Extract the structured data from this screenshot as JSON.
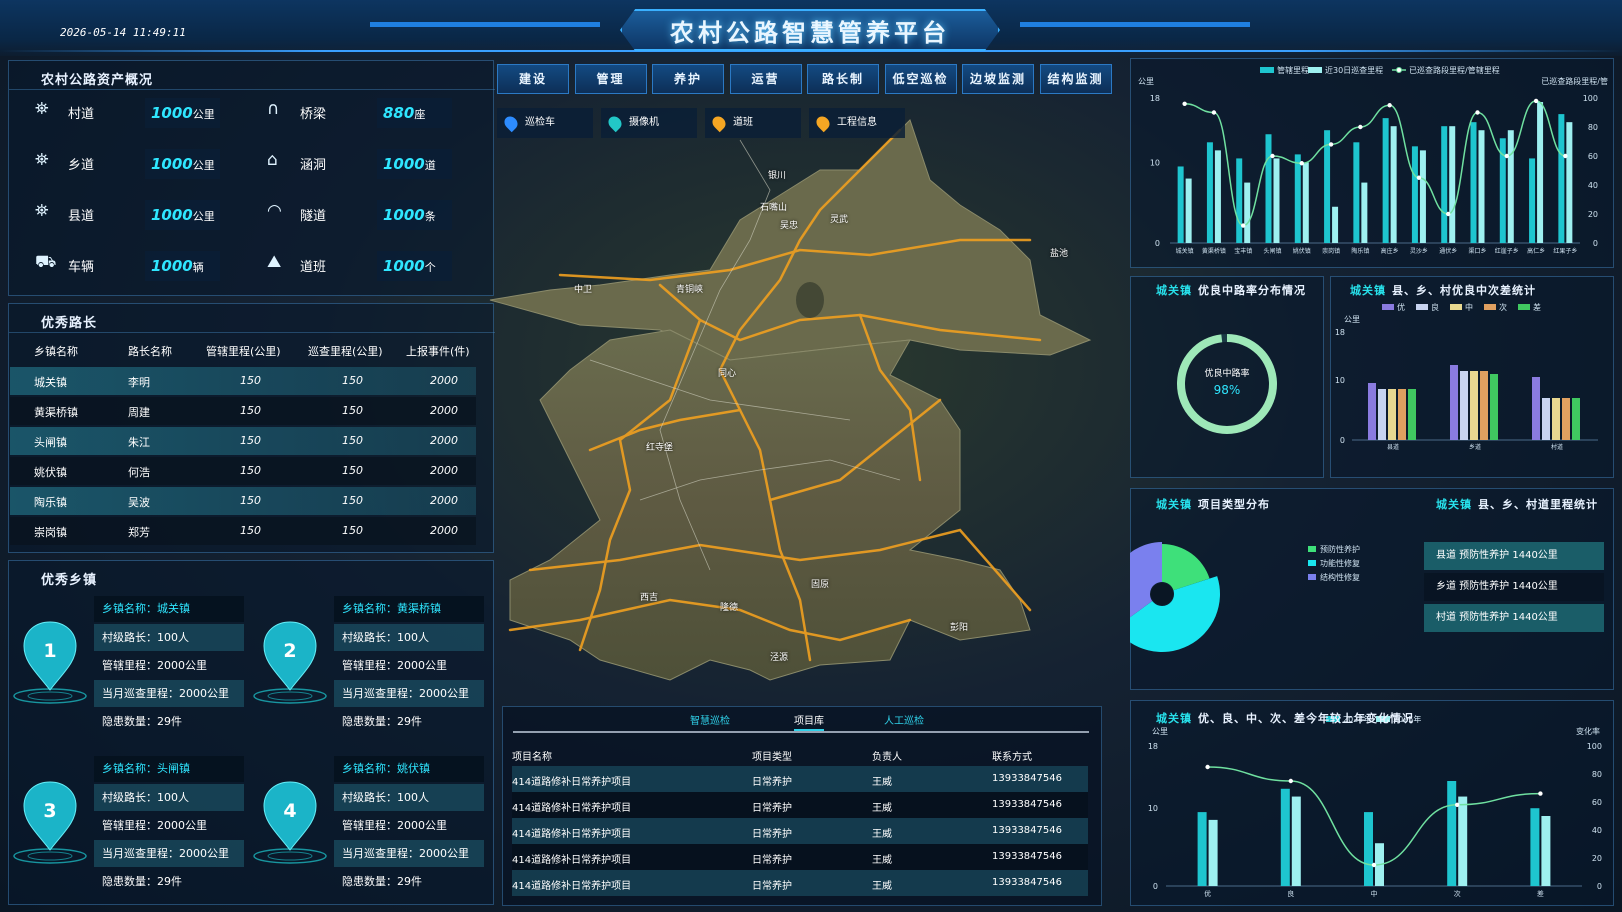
{
  "header": {
    "datetime": "2026-05-14 11:49:11",
    "title": "农村公路智慧管养平台"
  },
  "assets": {
    "title": "农村公路资产概况",
    "items": [
      {
        "icon": "road-icon",
        "label": "村道",
        "value": "1000",
        "unit": "公里"
      },
      {
        "icon": "bridge-icon",
        "label": "桥梁",
        "value": "880",
        "unit": "座"
      },
      {
        "icon": "road-icon",
        "label": "乡道",
        "value": "1000",
        "unit": "公里"
      },
      {
        "icon": "culvert-icon",
        "label": "涵洞",
        "value": "1000",
        "unit": "道"
      },
      {
        "icon": "road-icon",
        "label": "县道",
        "value": "1000",
        "unit": "公里"
      },
      {
        "icon": "tunnel-icon",
        "label": "隧道",
        "value": "1000",
        "unit": "条"
      },
      {
        "icon": "truck-icon",
        "label": "车辆",
        "value": "1000",
        "unit": "辆"
      },
      {
        "icon": "mountain-icon",
        "label": "道班",
        "value": "1000",
        "unit": "个"
      }
    ]
  },
  "leaders": {
    "title": "优秀路长",
    "headers": [
      "乡镇名称",
      "路长名称",
      "管辖里程(公里)",
      "巡查里程(公里)",
      "上报事件(件)"
    ],
    "rows": [
      [
        "城关镇",
        "李明",
        "150",
        "150",
        "2000"
      ],
      [
        "黄渠桥镇",
        "周建",
        "150",
        "150",
        "2000"
      ],
      [
        "头闸镇",
        "朱江",
        "150",
        "150",
        "2000"
      ],
      [
        "姚伏镇",
        "何浩",
        "150",
        "150",
        "2000"
      ],
      [
        "陶乐镇",
        "吴波",
        "150",
        "150",
        "2000"
      ],
      [
        "崇岗镇",
        "郑芳",
        "150",
        "150",
        "2000"
      ]
    ]
  },
  "towns": {
    "title": "优秀乡镇",
    "cards": [
      {
        "rank": "1",
        "name": "乡镇名称：城关镇",
        "l1": "村级路长：100人",
        "l2": "管辖里程：2000公里",
        "l3": "当月巡查里程：2000公里",
        "l4": "隐患数量：29件"
      },
      {
        "rank": "2",
        "name": "乡镇名称：黄渠桥镇",
        "l1": "村级路长：100人",
        "l2": "管辖里程：2000公里",
        "l3": "当月巡查里程：2000公里",
        "l4": "隐患数量：29件"
      },
      {
        "rank": "3",
        "name": "乡镇名称：头闸镇",
        "l1": "村级路长：100人",
        "l2": "管辖里程：2000公里",
        "l3": "当月巡查里程：2000公里",
        "l4": "隐患数量：29件"
      },
      {
        "rank": "4",
        "name": "乡镇名称：姚伏镇",
        "l1": "村级路长：100人",
        "l2": "管辖里程：2000公里",
        "l3": "当月巡查里程：2000公里",
        "l4": "隐患数量：29件"
      }
    ]
  },
  "nav": {
    "tabs": [
      "建设",
      "管理",
      "养护",
      "运营",
      "路长制",
      "低空巡检",
      "边坡监测",
      "结构监测"
    ],
    "layers": [
      "巡检车",
      "摄像机",
      "道班",
      "工程信息"
    ],
    "layer_colors": [
      "#2d8cff",
      "#22c7c7",
      "#f5a623",
      "#f5a623"
    ]
  },
  "map": {
    "labels": [
      "银川",
      "石嘴山",
      "吴忠",
      "中卫",
      "固原",
      "灵武",
      "青铜峡",
      "同心",
      "盐池",
      "西吉",
      "隆德",
      "泾源",
      "彭阳",
      "红寺堡"
    ]
  },
  "projects": {
    "tabs": [
      "智慧巡检",
      "项目库",
      "人工巡检"
    ],
    "active_tab": 1,
    "headers": [
      "项目名称",
      "项目类型",
      "负责人",
      "联系方式"
    ],
    "rows": [
      [
        "414道路修补日常养护项目",
        "日常养护",
        "王威",
        "13933847546"
      ],
      [
        "414道路修补日常养护项目",
        "日常养护",
        "王威",
        "13933847546"
      ],
      [
        "414道路修补日常养护项目",
        "日常养护",
        "王威",
        "13933847546"
      ],
      [
        "414道路修补日常养护项目",
        "日常养护",
        "王威",
        "13933847546"
      ],
      [
        "414道路修补日常养护项目",
        "日常养护",
        "王威",
        "13933847546"
      ]
    ]
  },
  "top_chart": {
    "legend": [
      "管辖里程",
      "近30日巡查里程",
      "已巡查路段里程/管辖里程"
    ],
    "y_left_unit": "公里",
    "y_right_label": "已巡查路段里程/管",
    "left_ticks": [
      "0",
      "10",
      "18"
    ],
    "right_ticks": [
      "0",
      "20",
      "40",
      "60",
      "80",
      "100"
    ]
  },
  "good_rate": {
    "title_hl": "城关镇",
    "title": "优良中路率分布情况",
    "label": "优良中路率",
    "value": "98%",
    "percent": 98
  },
  "grade_chart": {
    "title_hl": "城关镇",
    "title": "县、乡、村优良中次差统计",
    "legend": [
      "优",
      "良",
      "中",
      "次",
      "差"
    ],
    "unit": "公里",
    "ticks": [
      "0",
      "10",
      "18"
    ]
  },
  "project_type": {
    "title_hl": "城关镇",
    "title": "项目类型分布",
    "legend": [
      "预防性养护",
      "功能性修复",
      "结构性修复"
    ]
  },
  "mileage": {
    "title_hl": "城关镇",
    "title": "县、乡、村道里程统计",
    "rows": [
      "县道  预防性养护  1440公里",
      "乡道  预防性养护  1440公里",
      "村道  预防性养护  1440公里"
    ]
  },
  "trend": {
    "title_hl": "城关镇",
    "title": "优、良、中、次、差今年较上年变化情况",
    "legend": [
      "2024年",
      "2025年"
    ],
    "unit": "公里",
    "right_label": "变化率",
    "left_ticks": [
      "0",
      "10",
      "18"
    ],
    "right_ticks": [
      "0",
      "20",
      "40",
      "60",
      "80",
      "100"
    ]
  },
  "chart_data": [
    {
      "type": "bar",
      "id": "inspection",
      "categories": [
        "城关镇",
        "黄渠桥镇",
        "宝丰镇",
        "头闸镇",
        "姚伏镇",
        "崇岗镇",
        "陶乐镇",
        "高庄乡",
        "灵沙乡",
        "通伏乡",
        "渠口乡",
        "红崖子乡",
        "高仁乡",
        "红果子乡"
      ],
      "ylim": [
        0,
        18
      ],
      "y2lim": [
        0,
        100
      ],
      "series": [
        {
          "name": "管辖里程",
          "values": [
            9.5,
            12.5,
            10.5,
            13.5,
            11,
            14,
            12.5,
            15.5,
            12,
            14.5,
            15,
            13,
            10.5,
            16
          ]
        },
        {
          "name": "近30日巡查里程",
          "values": [
            8,
            11.5,
            7.5,
            10.5,
            10,
            4.5,
            7.5,
            14.5,
            11.5,
            14.5,
            14,
            14,
            17.5,
            15
          ]
        },
        {
          "name": "已巡查路段里程/管辖里程",
          "axis": "right",
          "values": [
            96,
            90,
            12,
            60,
            55,
            68,
            80,
            95,
            45,
            20,
            90,
            60,
            98,
            60
          ]
        }
      ]
    },
    {
      "type": "bar",
      "id": "grade",
      "categories": [
        "县道",
        "乡道",
        "村道"
      ],
      "ylim": [
        0,
        18
      ],
      "series": [
        {
          "name": "优",
          "values": [
            9.5,
            12.5,
            10.5
          ]
        },
        {
          "name": "良",
          "values": [
            8.5,
            11.5,
            7
          ]
        },
        {
          "name": "中",
          "values": [
            8.5,
            11.5,
            7
          ]
        },
        {
          "name": "次",
          "values": [
            8.5,
            11.5,
            7
          ]
        },
        {
          "name": "差",
          "values": [
            8.5,
            11,
            7
          ]
        }
      ]
    },
    {
      "type": "pie",
      "id": "project_type",
      "labels": [
        "预防性养护",
        "功能性修复",
        "结构性修复"
      ],
      "values": [
        20,
        45,
        35
      ]
    },
    {
      "type": "bar",
      "id": "trend",
      "categories": [
        "优",
        "良",
        "中",
        "次",
        "差"
      ],
      "ylim": [
        0,
        18
      ],
      "y2lim": [
        0,
        100
      ],
      "series": [
        {
          "name": "2024年",
          "values": [
            9.5,
            12.5,
            9.5,
            13.5,
            10
          ]
        },
        {
          "name": "2025年",
          "values": [
            8.5,
            11.5,
            5.5,
            11.5,
            9
          ]
        },
        {
          "name": "变化率",
          "axis": "right",
          "values": [
            85,
            75,
            15,
            58,
            66
          ]
        }
      ]
    }
  ]
}
